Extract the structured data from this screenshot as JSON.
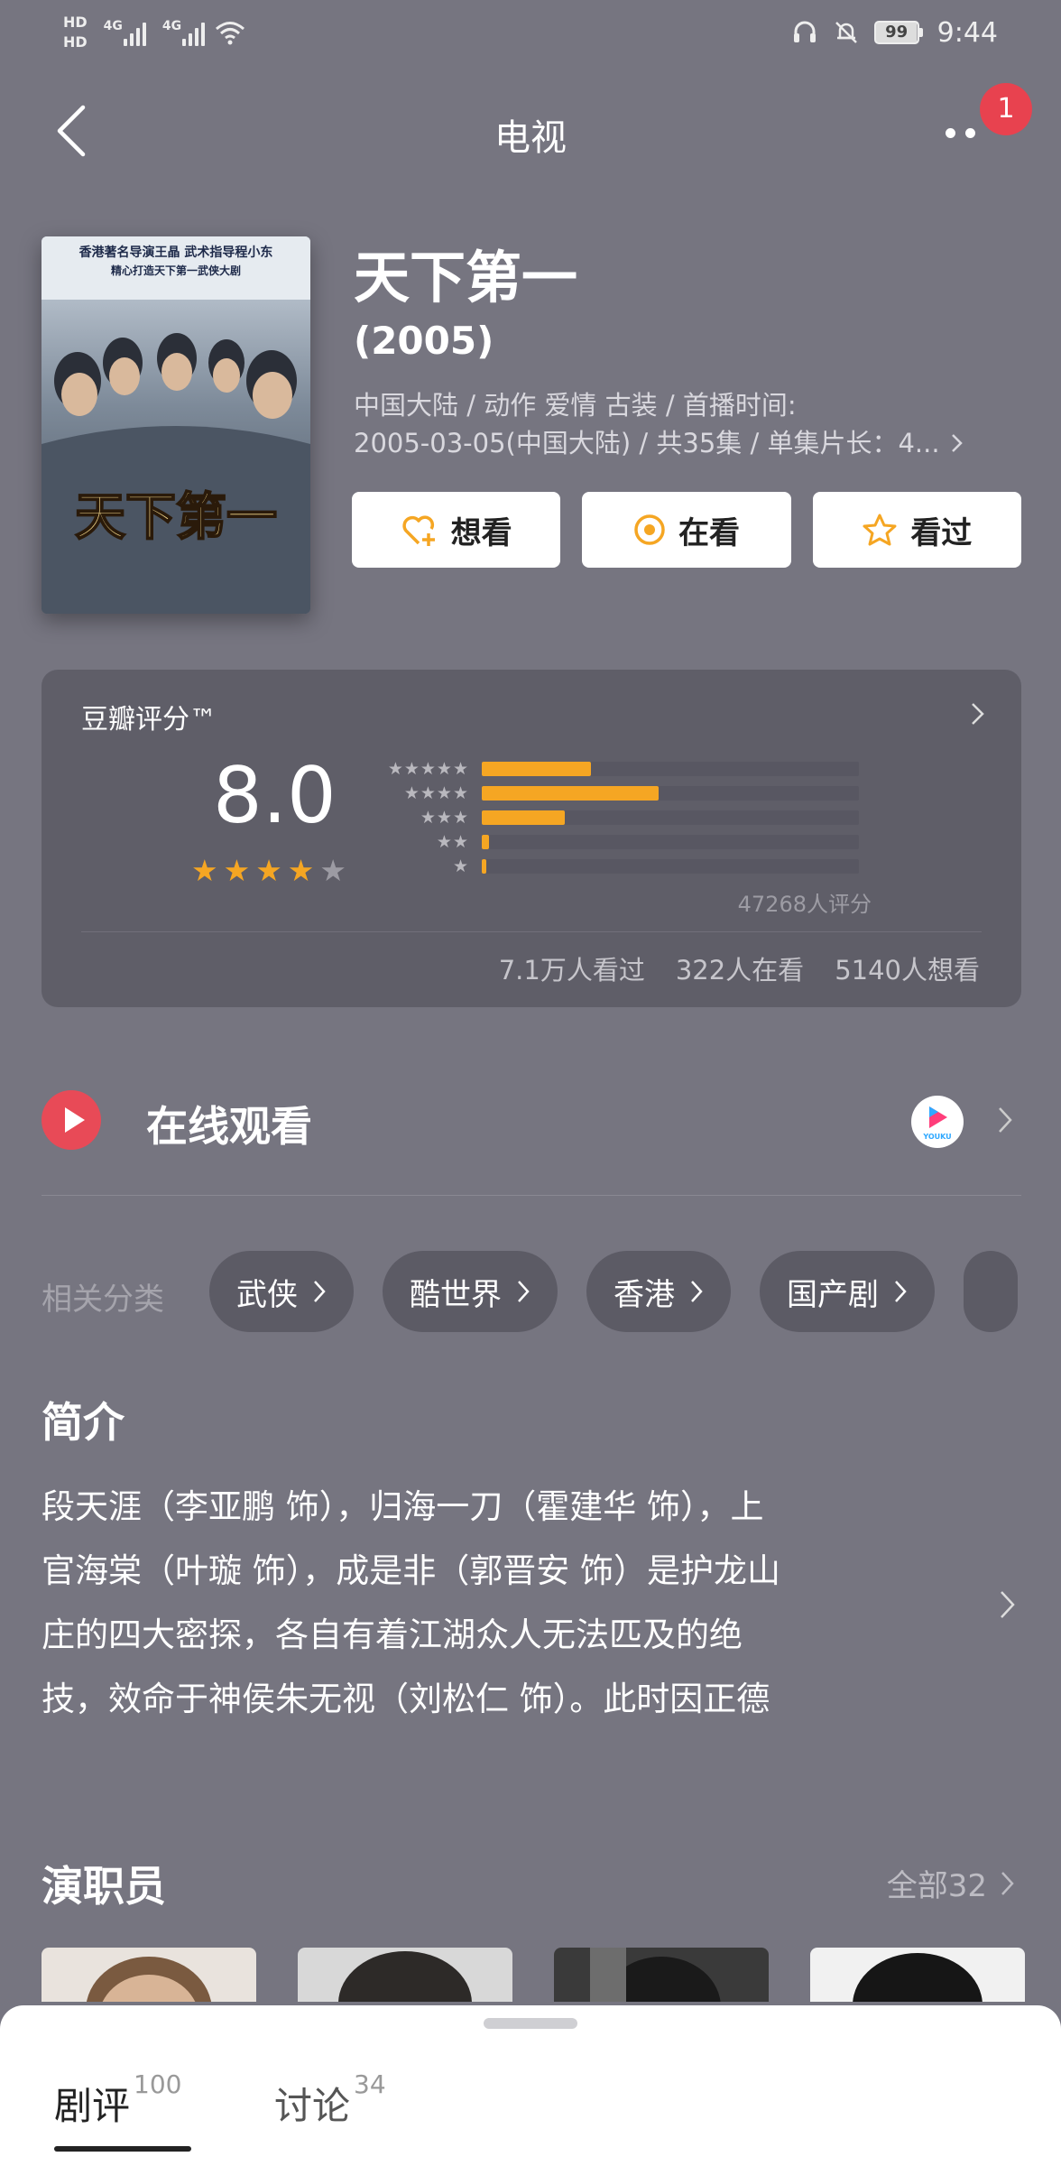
{
  "status_bar": {
    "hd1": "HD",
    "hd2": "HD",
    "net1": "4G",
    "net2": "4G",
    "battery": "99",
    "time": "9:44"
  },
  "nav": {
    "title": "电视",
    "badge_count": "1"
  },
  "show": {
    "title": "天下第一",
    "year": "(2005)",
    "meta_line1": "中国大陆 / 动作 爱情 古装 / 首播时间:",
    "meta_line2": "2005-03-05(中国大陆) / 共35集 / 单集片长：4..."
  },
  "poster": {
    "top_text1": "香港著名导演王晶 武术指导程小东",
    "top_text2": "精心打造天下第一武侠大剧",
    "calligraphy": "天下第一"
  },
  "actions": [
    {
      "label": "想看",
      "icon": "heart-plus-icon"
    },
    {
      "label": "在看",
      "icon": "target-icon"
    },
    {
      "label": "看过",
      "icon": "star-outline-icon"
    }
  ],
  "rating": {
    "label": "豆瓣评分™",
    "score": "8.0",
    "stars_filled": 4,
    "stars_total": 5,
    "distribution": [
      {
        "stars": "★★★★★",
        "fraction": 0.29
      },
      {
        "stars": "★★★★",
        "fraction": 0.47
      },
      {
        "stars": "★★★",
        "fraction": 0.22
      },
      {
        "stars": "★★",
        "fraction": 0.02
      },
      {
        "stars": "★",
        "fraction": 0.01
      }
    ],
    "count_text": "47268人评分",
    "stats": [
      "7.1万人看过",
      "322人在看",
      "5140人想看"
    ],
    "accent_color": "#f5a623"
  },
  "online": {
    "title": "在线观看",
    "provider": "YOUKU"
  },
  "related": {
    "label": "相关分类",
    "chips": [
      "武侠",
      "酷世界",
      "香港",
      "国产剧"
    ]
  },
  "synopsis": {
    "title": "简介",
    "lines": [
      "段天涯（李亚鹏 饰），归海一刀（霍建华 饰），上",
      "官海棠（叶璇 饰），成是非（郭晋安 饰）是护龙山",
      "庄的四大密探，各自有着江湖众人无法匹及的绝",
      "技，效命于神侯朱无视（刘松仁 饰）。此时因正德"
    ]
  },
  "cast": {
    "title": "演职员",
    "all_label": "全部32"
  },
  "sheet": {
    "tabs": [
      {
        "label": "剧评",
        "count": "100"
      },
      {
        "label": "讨论",
        "count": "34"
      }
    ]
  }
}
